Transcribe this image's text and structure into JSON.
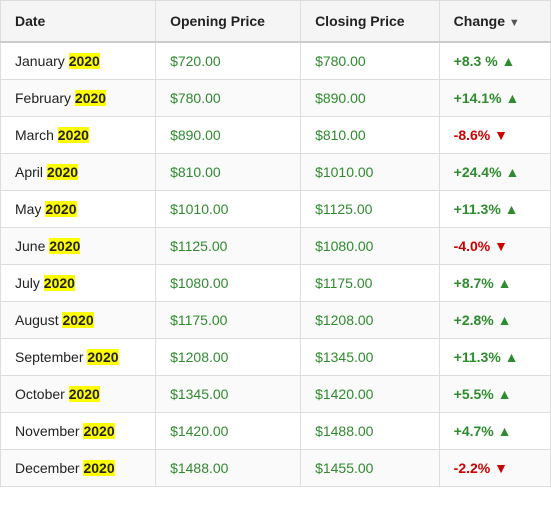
{
  "table": {
    "columns": [
      {
        "label": "Date",
        "key": "date"
      },
      {
        "label": "Opening Price",
        "key": "opening"
      },
      {
        "label": "Closing Price",
        "key": "closing"
      },
      {
        "label": "Change",
        "key": "change",
        "sortable": true
      }
    ],
    "rows": [
      {
        "month": "January",
        "year": "2020",
        "opening": "$720.00",
        "closing": "$780.00",
        "change": "+8.3 %",
        "positive": true
      },
      {
        "month": "February",
        "year": "2020",
        "opening": "$780.00",
        "closing": "$890.00",
        "change": "+14.1%",
        "positive": true
      },
      {
        "month": "March",
        "year": "2020",
        "opening": "$890.00",
        "closing": "$810.00",
        "change": "-8.6%",
        "positive": false
      },
      {
        "month": "April",
        "year": "2020",
        "opening": "$810.00",
        "closing": "$1010.00",
        "change": "+24.4%",
        "positive": true
      },
      {
        "month": "May",
        "year": "2020",
        "opening": "$1010.00",
        "closing": "$1125.00",
        "change": "+11.3%",
        "positive": true
      },
      {
        "month": "June",
        "year": "2020",
        "opening": "$1125.00",
        "closing": "$1080.00",
        "change": "-4.0%",
        "positive": false
      },
      {
        "month": "July",
        "year": "2020",
        "opening": "$1080.00",
        "closing": "$1175.00",
        "change": "+8.7%",
        "positive": true
      },
      {
        "month": "August",
        "year": "2020",
        "opening": "$1175.00",
        "closing": "$1208.00",
        "change": "+2.8%",
        "positive": true
      },
      {
        "month": "September",
        "year": "2020",
        "opening": "$1208.00",
        "closing": "$1345.00",
        "change": "+11.3%",
        "positive": true
      },
      {
        "month": "October",
        "year": "2020",
        "opening": "$1345.00",
        "closing": "$1420.00",
        "change": "+5.5%",
        "positive": true
      },
      {
        "month": "November",
        "year": "2020",
        "opening": "$1420.00",
        "closing": "$1488.00",
        "change": "+4.7%",
        "positive": true
      },
      {
        "month": "December",
        "year": "2020",
        "opening": "$1488.00",
        "closing": "$1455.00",
        "change": "-2.2%",
        "positive": false
      }
    ]
  }
}
